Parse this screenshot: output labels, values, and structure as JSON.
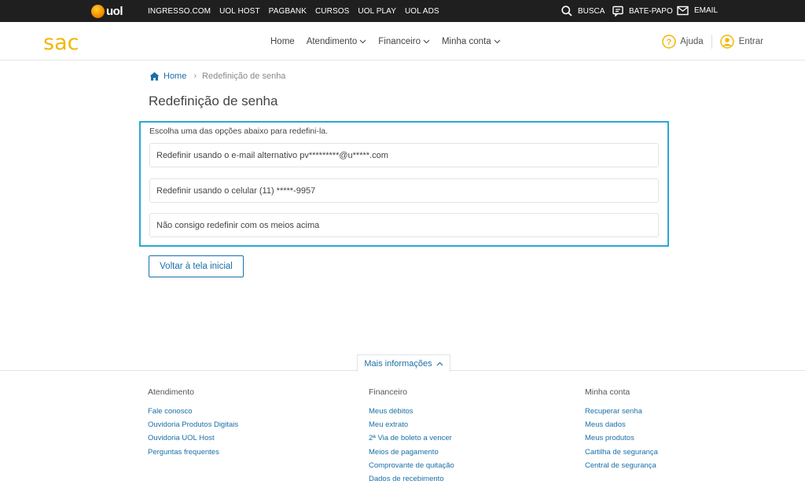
{
  "topbar": {
    "brand": "uol",
    "links": [
      "INGRESSO.COM",
      "UOL HOST",
      "PAGBANK",
      "CURSOS",
      "UOL PLAY",
      "UOL ADS"
    ],
    "busca": "BUSCA",
    "batepapo": "BATE-PAPO",
    "email": "EMAIL"
  },
  "header": {
    "logo": "sac",
    "nav": [
      "Home",
      "Atendimento",
      "Financeiro",
      "Minha conta"
    ],
    "ajuda": "Ajuda",
    "entrar": "Entrar"
  },
  "breadcrumb": {
    "home": "Home",
    "current": "Redefinição de senha"
  },
  "page": {
    "title": "Redefinição de senha",
    "intro": "Escolha uma das opções abaixo para redefini-la.",
    "options": [
      "Redefinir usando o e-mail alternativo pv*********@u*****.com",
      "Redefinir usando o celular (11) *****-9957",
      "Não consigo redefinir com os meios acima"
    ],
    "back_button": "Voltar à tela inicial"
  },
  "footer": {
    "more_label": "Mais informações",
    "columns": [
      {
        "title": "Atendimento",
        "links": [
          "Fale conosco",
          "Ouvidoria Produtos Digitais",
          "Ouvidoria UOL Host",
          "Perguntas frequentes"
        ]
      },
      {
        "title": "Financeiro",
        "links": [
          "Meus débitos",
          "Meu extrato",
          "2ª Via de boleto a vencer",
          "Meios de pagamento",
          "Comprovante de quitação",
          "Dados de recebimento"
        ]
      },
      {
        "title": "Minha conta",
        "links": [
          "Recuperar senha",
          "Meus dados",
          "Meus produtos",
          "Cartilha de segurança",
          "Central de segurança"
        ]
      }
    ]
  },
  "colors": {
    "accent": "#1a6fa8",
    "highlight_border": "#2aa8d6",
    "brand_yellow": "#f2b705",
    "topbar_bg": "#1f1f1f"
  }
}
